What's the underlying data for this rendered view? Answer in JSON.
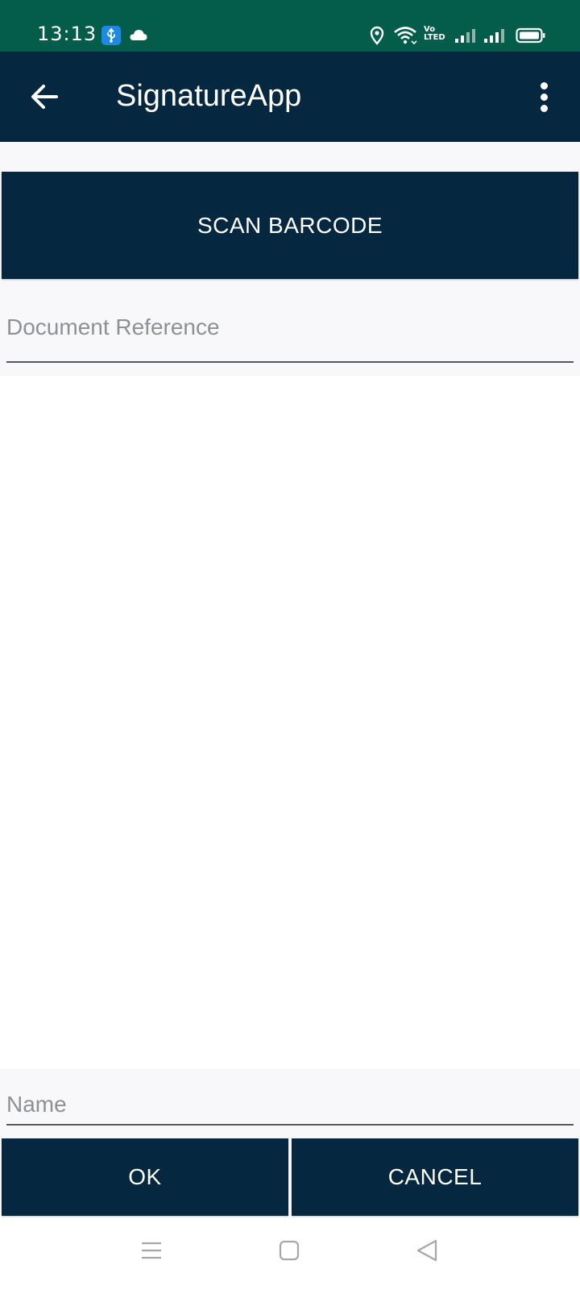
{
  "status_bar": {
    "time": "13:13",
    "volte_line1": "Vo",
    "volte_line2": "LTED",
    "icons": [
      "usb-icon",
      "cloud-icon",
      "location-icon",
      "wifi-icon",
      "signal-icon",
      "signal-icon",
      "battery-icon"
    ],
    "background": "#045c4a"
  },
  "app_bar": {
    "title": "SignatureApp",
    "back_icon": "arrow-left-icon",
    "menu_icon": "more-vertical-icon",
    "background": "#052840"
  },
  "scan": {
    "label": "SCAN BARCODE"
  },
  "document_reference": {
    "placeholder": "Document Reference",
    "value": ""
  },
  "name": {
    "placeholder": "Name",
    "value": ""
  },
  "actions": {
    "ok_label": "OK",
    "cancel_label": "CANCEL"
  },
  "nav_bar": {
    "icons": [
      "menu-icon",
      "home-icon",
      "back-icon"
    ]
  },
  "colors": {
    "primary": "#052840",
    "status": "#045c4a",
    "placeholder": "#8e9194",
    "surface": "#f8f8fa"
  }
}
